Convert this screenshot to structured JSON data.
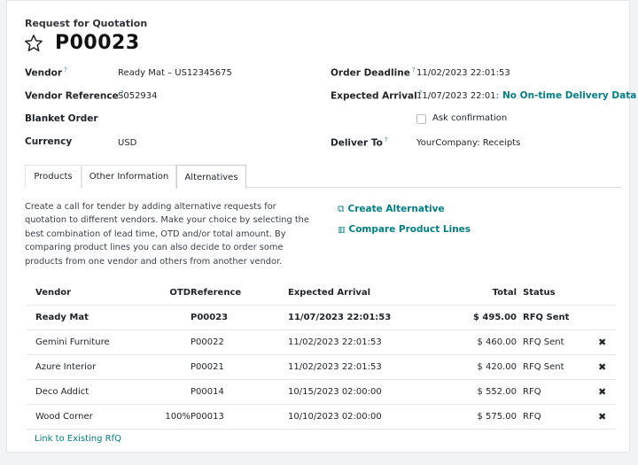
{
  "header": {
    "subtitle": "Request for Quotation",
    "title": "P00023"
  },
  "fields": {
    "vendor": {
      "label": "Vendor",
      "value": "Ready Mat – US12345675"
    },
    "vendor_reference": {
      "label": "Vendor Reference",
      "value": "S052934"
    },
    "blanket_order": {
      "label": "Blanket Order",
      "value": ""
    },
    "currency": {
      "label": "Currency",
      "value": "USD"
    },
    "order_deadline": {
      "label": "Order Deadline",
      "value": "11/02/2023 22:01:53"
    },
    "expected_arrival": {
      "label": "Expected Arrival",
      "value": "11/07/2023 22:01:5",
      "extra": "No On-time Delivery Data"
    },
    "ask_confirmation": {
      "label": "Ask confirmation",
      "checked": false
    },
    "deliver_to": {
      "label": "Deliver To",
      "value": "YourCompany: Receipts"
    },
    "help_mark": "?"
  },
  "tabs": [
    {
      "label": "Products",
      "active": false
    },
    {
      "label": "Other Information",
      "active": false
    },
    {
      "label": "Alternatives",
      "active": true
    }
  ],
  "alternatives": {
    "description": "Create a call for tender by adding alternative requests for quotation to different vendors. Make your choice by selecting the best combination of lead time, OTD and/or total amount. By comparing product lines you can also decide to order some products from one vendor and others from another vendor.",
    "create_label": "Create Alternative",
    "compare_label": "Compare Product Lines",
    "columns": {
      "vendor": "Vendor",
      "otd": "OTD",
      "reference": "Reference",
      "arrival": "Expected Arrival",
      "total": "Total",
      "status": "Status"
    },
    "rows": [
      {
        "vendor": "Ready Mat",
        "otd": "",
        "reference": "P00023",
        "arrival": "11/07/2023 22:01:53",
        "total": "$ 495.00",
        "status": "RFQ Sent",
        "current": true,
        "delete": ""
      },
      {
        "vendor": "Gemini Furniture",
        "otd": "",
        "reference": "P00022",
        "arrival": "11/02/2023 22:01:53",
        "total": "$ 460.00",
        "status": "RFQ Sent",
        "current": false,
        "delete": "✖"
      },
      {
        "vendor": "Azure Interior",
        "otd": "",
        "reference": "P00021",
        "arrival": "11/02/2023 22:01:53",
        "total": "$ 420.00",
        "status": "RFQ Sent",
        "current": false,
        "delete": "✖"
      },
      {
        "vendor": "Deco Addict",
        "otd": "",
        "reference": "P00014",
        "arrival": "10/15/2023 02:00:00",
        "total": "$ 552.00",
        "status": "RFQ",
        "current": false,
        "delete": "✖"
      },
      {
        "vendor": "Wood Corner",
        "otd": "100%",
        "reference": "P00013",
        "arrival": "10/10/2023 02:00:00",
        "total": "$ 575.00",
        "status": "RFQ",
        "current": false,
        "delete": "✖"
      }
    ],
    "link_label": "Link to Existing RfQ"
  },
  "icons": {
    "favorite": "star-outline-icon",
    "create": "copy-plus-icon",
    "compare": "bar-chart-icon",
    "delete": "close-icon"
  },
  "colors": {
    "accent": "#017e84",
    "help": "#3b8fb0"
  }
}
